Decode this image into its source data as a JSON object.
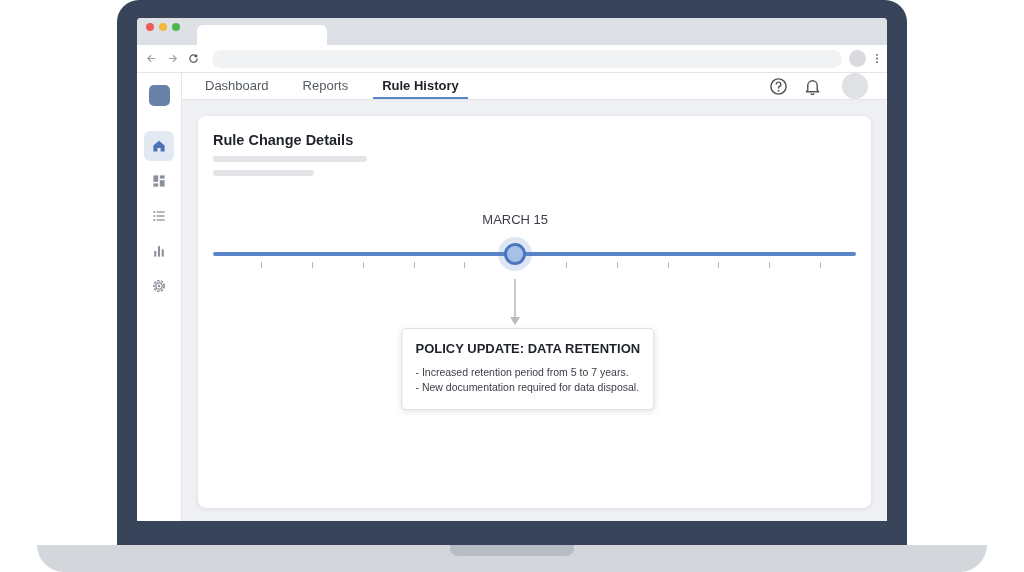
{
  "nav": {
    "tabs": [
      {
        "label": "Dashboard",
        "selected": false
      },
      {
        "label": "Reports",
        "selected": false
      },
      {
        "label": "Rule History",
        "selected": true
      }
    ]
  },
  "sidebar": {
    "items": [
      {
        "kind": "home",
        "selected": true
      },
      {
        "kind": "dashboard",
        "selected": false
      },
      {
        "kind": "list",
        "selected": false
      },
      {
        "kind": "chart",
        "selected": false
      },
      {
        "kind": "settings",
        "selected": false
      }
    ]
  },
  "card": {
    "title": "Rule Change Details",
    "timeline": {
      "date": "MARCH 15",
      "level": 0.47,
      "callout": {
        "title": "POLICY UPDATE: DATA RETENTION",
        "lines": [
          "- Increased retention period from 5 to 7 years.",
          "- New documentation required for data disposal."
        ]
      }
    }
  }
}
